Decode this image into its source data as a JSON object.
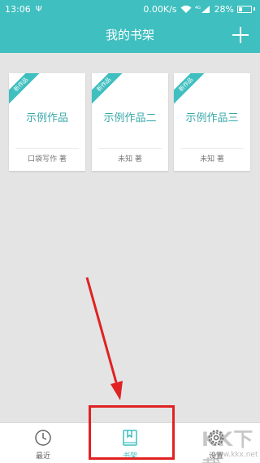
{
  "status_bar": {
    "time": "13:06",
    "usb": "Ψ",
    "speed": "0.00K/s",
    "signal_tag": "4G",
    "battery": "28%",
    "battery_level": 0.28
  },
  "app": {
    "title": "我的书架",
    "accent_color": "#3fbfbf"
  },
  "books": [
    {
      "badge": "新作品",
      "title": "示例作品",
      "author": "口袋写作 著"
    },
    {
      "badge": "新作品",
      "title": "示例作品二",
      "author": "未知 著"
    },
    {
      "badge": "新作品",
      "title": "示例作品三",
      "author": "未知 著"
    }
  ],
  "tabs": [
    {
      "label": "最近",
      "icon": "clock-icon"
    },
    {
      "label": "书架",
      "icon": "bookshelf-icon",
      "active": true
    },
    {
      "label": "设置",
      "icon": "gear-icon"
    }
  ],
  "annotation_color": "#e02222",
  "watermark": {
    "big": "KK下载",
    "small": "www.kkx.net"
  }
}
